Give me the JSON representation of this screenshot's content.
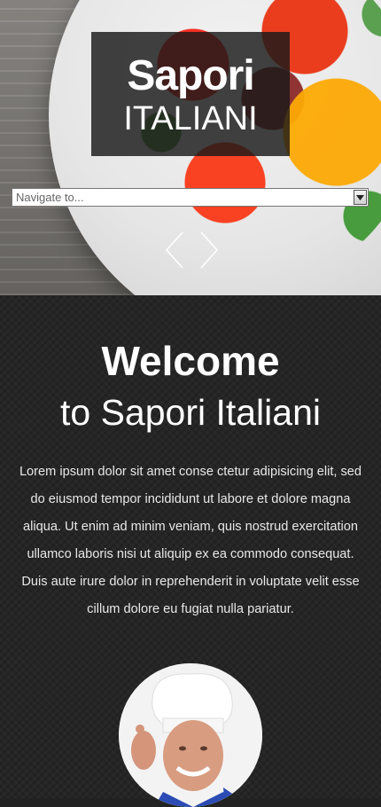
{
  "brand": {
    "line1": "Sapori",
    "line2": "ITALIANI"
  },
  "navigation": {
    "placeholder": "Navigate to..."
  },
  "slider": {
    "prev_icon": "chevron-left-icon",
    "next_icon": "chevron-right-icon"
  },
  "intro": {
    "title": "Welcome",
    "subtitle": "to Sapori Italiani",
    "paragraph": "Lorem ipsum dolor sit amet conse ctetur adipisicing elit, sed do eiusmod tempor incididunt ut labore et dolore magna aliqua. Ut enim ad minim veniam, quis nostrud exercitation ullamco laboris nisi ut aliquip ex ea commodo consequat. Duis aute irure dolor in reprehenderit in voluptate velit esse cillum dolore eu fugiat nulla pariatur."
  },
  "colors": {
    "dark_bg": "#252525",
    "logo_bg": "#191919",
    "text": "#ffffff"
  }
}
